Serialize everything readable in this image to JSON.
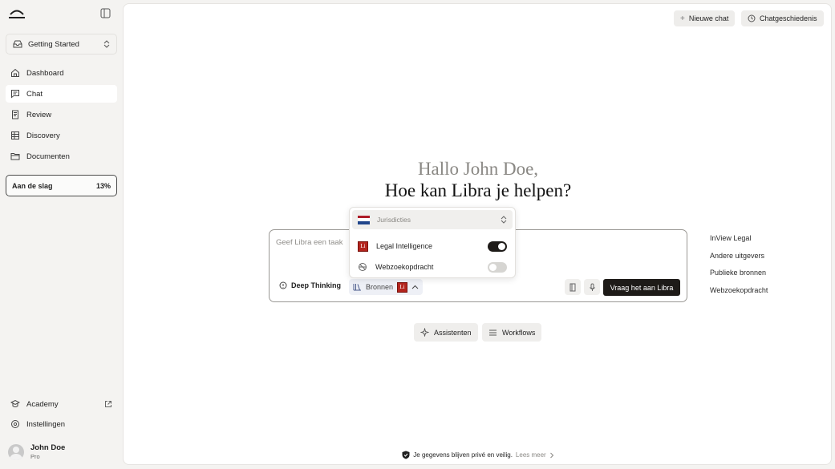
{
  "colors": {
    "sidebar_bg": "#f4f3f1",
    "accent_dark": "#1e1b18",
    "brand_red": "#b3241d",
    "flag_red": "#ae1c28",
    "flag_white": "#ffffff",
    "flag_blue": "#21468b"
  },
  "sidebar": {
    "logo_icon": "libra-scale-logo",
    "collapse_icon": "sidebar-toggle-icon",
    "workspace": {
      "label": "Getting Started",
      "icon": "inbox-icon"
    },
    "nav": [
      {
        "label": "Dashboard",
        "icon": "home-icon",
        "active": false
      },
      {
        "label": "Chat",
        "icon": "chat-icon",
        "active": true
      },
      {
        "label": "Review",
        "icon": "document-icon",
        "active": false
      },
      {
        "label": "Discovery",
        "icon": "table-icon",
        "active": false
      },
      {
        "label": "Documenten",
        "icon": "folder-icon",
        "active": false
      }
    ],
    "progress": {
      "label": "Aan de slag",
      "value_text": "13%",
      "value": 0.13
    },
    "bottom": [
      {
        "label": "Academy",
        "icon": "academy-icon"
      },
      {
        "label": "Instellingen",
        "icon": "gear-icon"
      }
    ],
    "user": {
      "name": "John Doe",
      "plan": "Pro"
    }
  },
  "header": {
    "new_chat": "Nieuwe chat",
    "history": "Chatgeschiedenis"
  },
  "greeting": {
    "line1": "Hallo John Doe,",
    "line2": "Hoe kan Libra je helpen?"
  },
  "composer": {
    "placeholder": "Geef Libra een taak",
    "deep_thinking": "Deep Thinking",
    "sources_label": "Bronnen",
    "sources_badge": "Li",
    "submit": "Vraag het aan Libra"
  },
  "dropdown": {
    "jurisdiction_label": "Jurisdicties",
    "options": [
      {
        "label": "Legal Intelligence",
        "badge": "Li",
        "enabled": true
      },
      {
        "label": "Webzoekopdracht",
        "icon": "globe-off-icon",
        "enabled": false
      }
    ]
  },
  "side_sources": [
    "InView Legal",
    "Andere uitgevers",
    "Publieke bronnen",
    "Webzoekopdracht"
  ],
  "quick_actions": [
    {
      "label": "Assistenten",
      "icon": "sparkle-icon"
    },
    {
      "label": "Workflows",
      "icon": "list-icon"
    }
  ],
  "privacy": {
    "text": "Je gegevens blijven privé en veilig.",
    "link": "Lees meer"
  }
}
